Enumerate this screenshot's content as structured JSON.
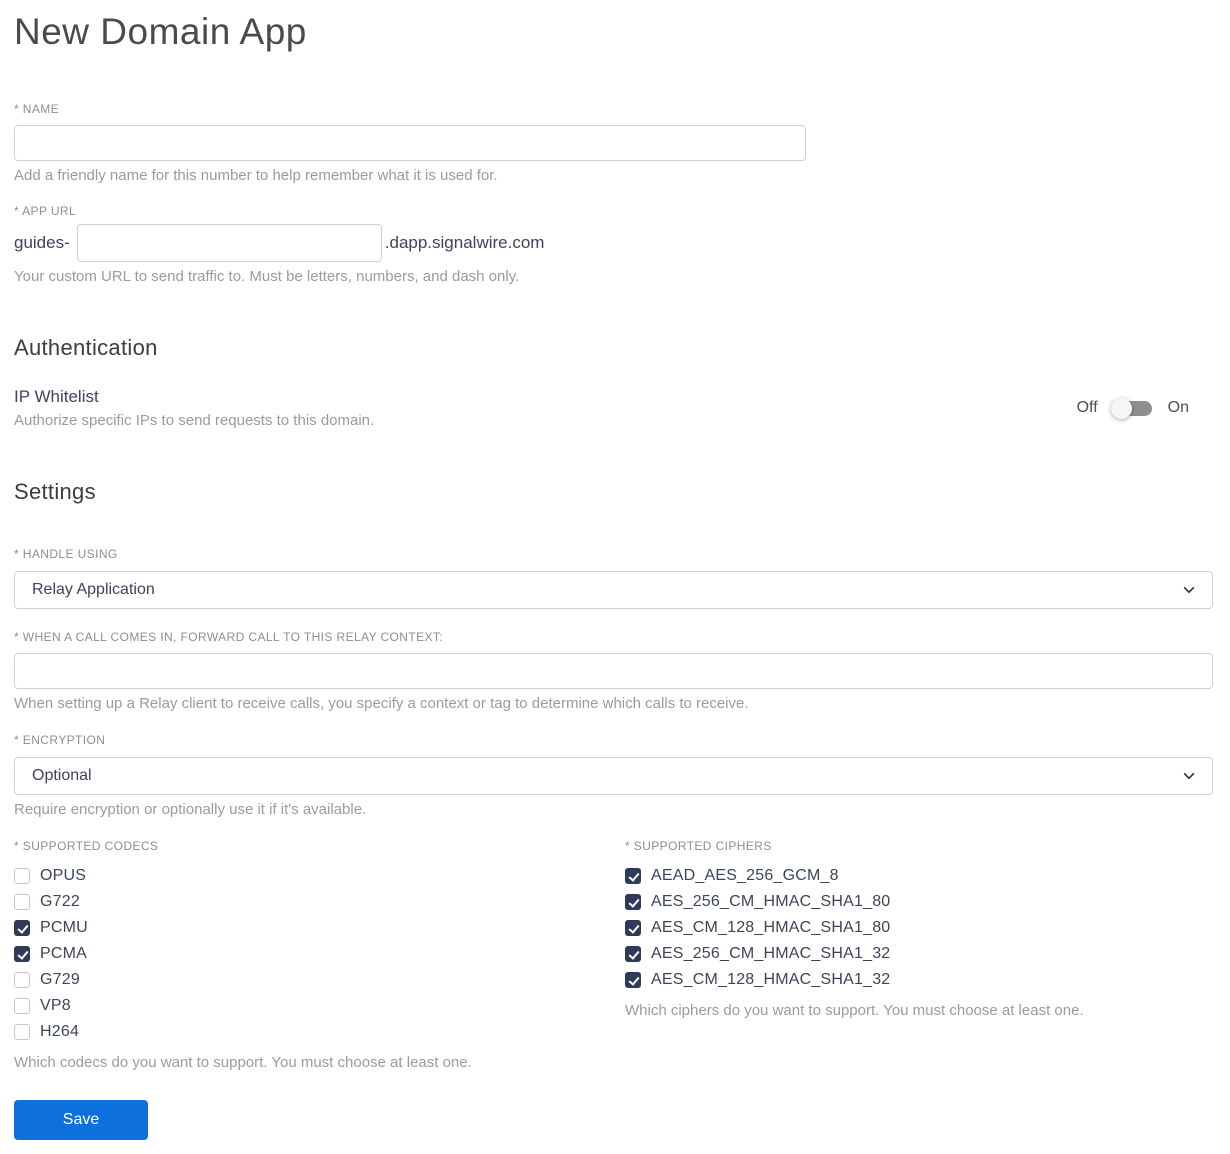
{
  "page": {
    "title": "New Domain App"
  },
  "colors": {
    "accent_blue": "#0d70dd",
    "checkbox_checked": "#2e3a59",
    "toggle_track": "#8f8f8f",
    "input_border": "#ccd2d9",
    "label_gray": "#8e8e8e",
    "helper_gray": "#9b9b9b",
    "text_dark": "#3e4458"
  },
  "name_field": {
    "label": "* NAME",
    "value": "",
    "helper": "Add a friendly name for this number to help remember what it is used for."
  },
  "app_url_field": {
    "label": "* APP URL",
    "prefix": "guides-",
    "value": "",
    "suffix": ".dapp.signalwire.com",
    "helper": "Your custom URL to send traffic to. Must be letters, numbers, and dash only."
  },
  "authentication": {
    "heading": "Authentication",
    "ip_whitelist": {
      "label": "IP Whitelist",
      "helper": "Authorize specific IPs to send requests to this domain.",
      "off_label": "Off",
      "on_label": "On",
      "state": "off"
    }
  },
  "settings": {
    "heading": "Settings",
    "handle_using": {
      "label": "* HANDLE USING",
      "value": "Relay Application"
    },
    "relay_context": {
      "label": "* WHEN A CALL COMES IN, FORWARD CALL TO THIS RELAY CONTEXT:",
      "value": "",
      "helper": "When setting up a Relay client to receive calls, you specify a context or tag to determine which calls to receive."
    },
    "encryption": {
      "label": "* ENCRYPTION",
      "value": "Optional",
      "helper": "Require encryption or optionally use it if it's available."
    },
    "codecs": {
      "label": "* SUPPORTED CODECS",
      "options": [
        {
          "label": "OPUS",
          "checked": false
        },
        {
          "label": "G722",
          "checked": false
        },
        {
          "label": "PCMU",
          "checked": true
        },
        {
          "label": "PCMA",
          "checked": true
        },
        {
          "label": "G729",
          "checked": false
        },
        {
          "label": "VP8",
          "checked": false
        },
        {
          "label": "H264",
          "checked": false
        }
      ],
      "helper": "Which codecs do you want to support. You must choose at least one."
    },
    "ciphers": {
      "label": "* SUPPORTED CIPHERS",
      "options": [
        {
          "label": "AEAD_AES_256_GCM_8",
          "checked": true
        },
        {
          "label": "AES_256_CM_HMAC_SHA1_80",
          "checked": true
        },
        {
          "label": "AES_CM_128_HMAC_SHA1_80",
          "checked": true
        },
        {
          "label": "AES_256_CM_HMAC_SHA1_32",
          "checked": true
        },
        {
          "label": "AES_CM_128_HMAC_SHA1_32",
          "checked": true
        }
      ],
      "helper": "Which ciphers do you want to support. You must choose at least one."
    }
  },
  "save_button": {
    "label": "Save"
  }
}
